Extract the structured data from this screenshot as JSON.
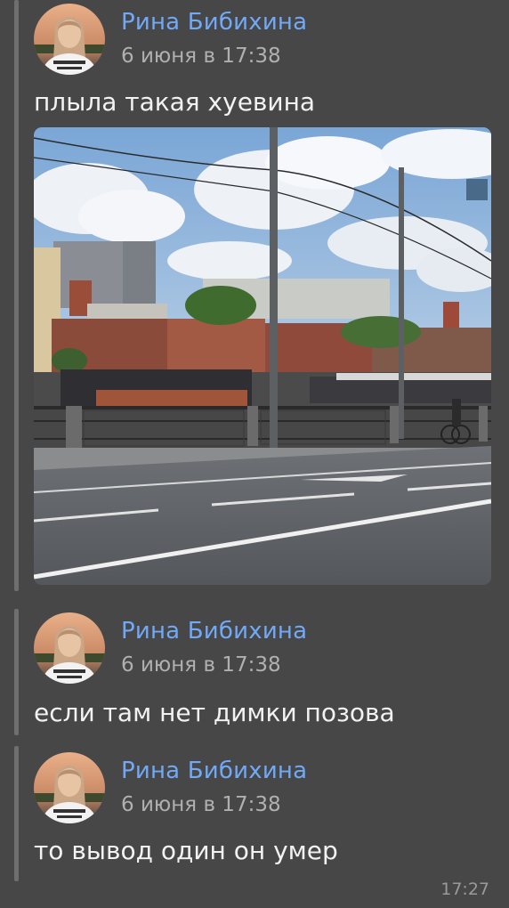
{
  "messages": [
    {
      "author": "Рина Бибихина",
      "date": "6 июня в 17:38",
      "text": "плыла такая хуевина"
    },
    {
      "author": "Рина Бибихина",
      "date": "6 июня в 17:38",
      "text": "если там нет димки позова"
    },
    {
      "author": "Рина Бибихина",
      "date": "6 июня в 17:38",
      "text": "то вывод один он умер"
    }
  ],
  "bubble_time": "17:27",
  "icons": [
    "avatar-image",
    "attached-photo"
  ]
}
